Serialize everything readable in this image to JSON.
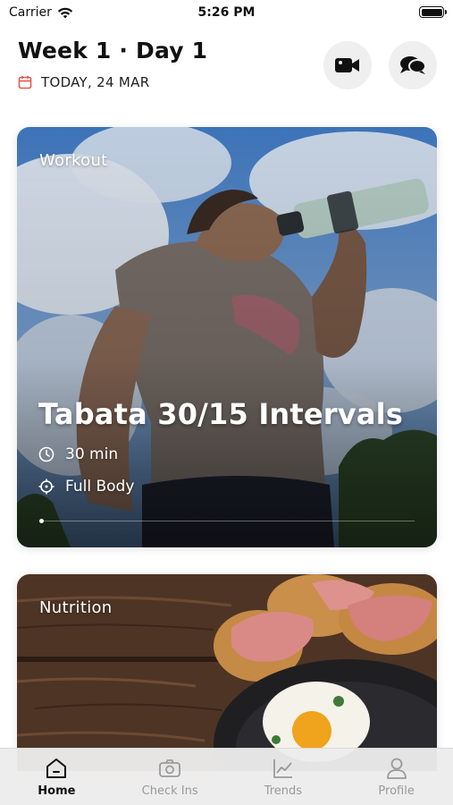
{
  "status_bar": {
    "carrier": "Carrier",
    "time": "5:26 PM",
    "wifi_icon": "wifi-icon",
    "battery_icon": "battery-icon"
  },
  "header": {
    "title": "Week 1 · Day 1",
    "date": "TODAY, 24 MAR",
    "date_icon": "calendar-icon",
    "date_icon_color": "#e8574f",
    "video_button_icon": "video-camera-icon",
    "chat_button_icon": "chat-bubbles-icon"
  },
  "workout_card": {
    "label": "Workout",
    "title": "Tabata 30/15 Intervals",
    "duration": "30 min",
    "duration_icon": "clock-icon",
    "focus": "Full Body",
    "focus_icon": "target-icon"
  },
  "nutrition_card": {
    "label": "Nutrition"
  },
  "tabbar": {
    "tabs": [
      {
        "label": "Home",
        "icon": "home-icon",
        "active": true
      },
      {
        "label": "Check Ins",
        "icon": "camera-icon",
        "active": false
      },
      {
        "label": "Trends",
        "icon": "chart-icon",
        "active": false
      },
      {
        "label": "Profile",
        "icon": "user-icon",
        "active": false
      }
    ],
    "active_color": "#111111",
    "inactive_color": "#9a9a9a"
  }
}
